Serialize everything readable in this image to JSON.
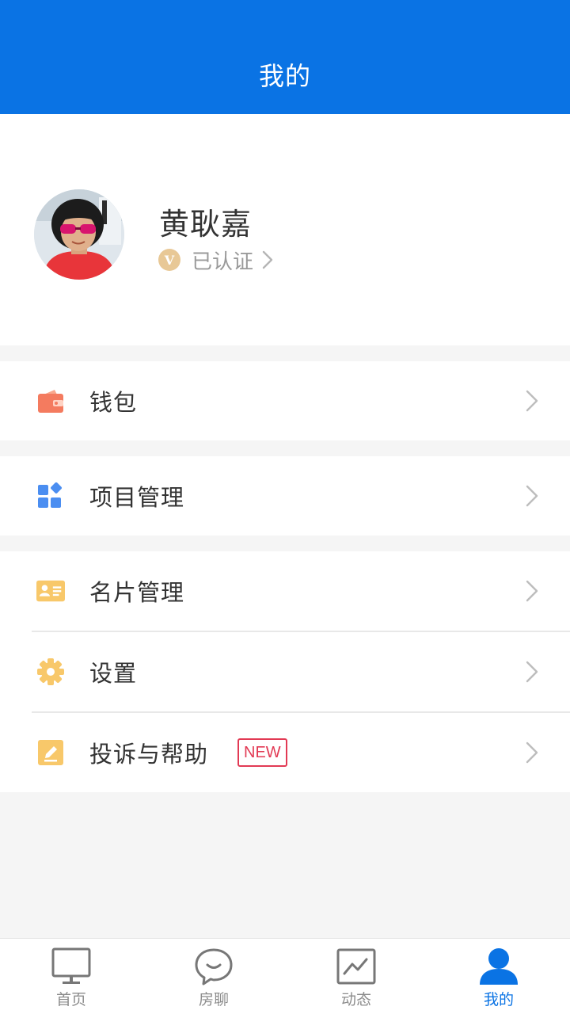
{
  "header": {
    "title": "我的"
  },
  "profile": {
    "name": "黄耿嘉",
    "badge_letter": "V",
    "verify_status": "已认证"
  },
  "menu": {
    "wallet": {
      "label": "钱包",
      "icon": "wallet-icon"
    },
    "projects": {
      "label": "项目管理",
      "icon": "grid-apps-icon"
    },
    "cards": {
      "label": "名片管理",
      "icon": "business-card-icon"
    },
    "settings": {
      "label": "设置",
      "icon": "gear-icon"
    },
    "help": {
      "label": "投诉与帮助",
      "icon": "edit-note-icon",
      "tag": "NEW"
    }
  },
  "tabbar": {
    "tabs": [
      {
        "label": "首页",
        "icon": "monitor-icon"
      },
      {
        "label": "房聊",
        "icon": "chat-bubble-icon"
      },
      {
        "label": "动态",
        "icon": "trend-chart-icon"
      },
      {
        "label": "我的",
        "icon": "user-icon",
        "active": true
      }
    ]
  },
  "colors": {
    "primary": "#0a73e4",
    "wallet": "#f47b5f",
    "projects": "#4b8ef1",
    "cards": "#f8c86a",
    "new_tag": "#e23a54",
    "badge": "#e8c896"
  }
}
